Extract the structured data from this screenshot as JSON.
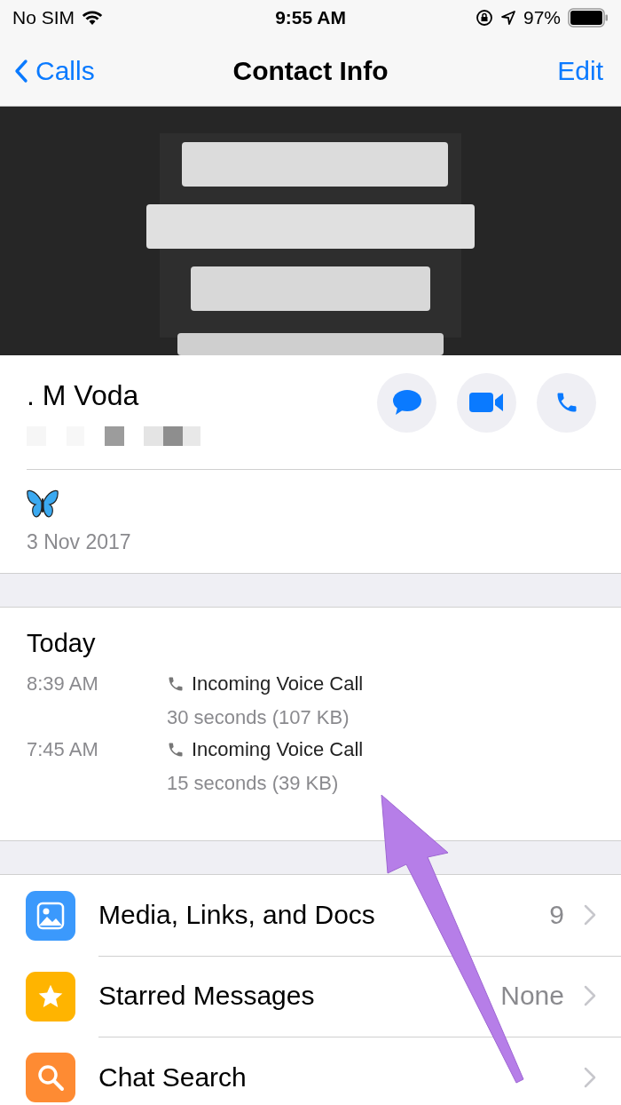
{
  "status_bar": {
    "carrier": "No SIM",
    "time": "9:55 AM",
    "battery": "97%"
  },
  "nav": {
    "back": "Calls",
    "title": "Contact Info",
    "action": "Edit"
  },
  "profile": {
    "name": ". M Voda"
  },
  "about": {
    "date": "3 Nov 2017"
  },
  "calls": {
    "heading": "Today",
    "entries": [
      {
        "time": "8:39 AM",
        "type": "Incoming Voice Call",
        "detail": "30 seconds (107 KB)"
      },
      {
        "time": "7:45 AM",
        "type": "Incoming Voice Call",
        "detail": "15 seconds (39 KB)"
      }
    ]
  },
  "menu": [
    {
      "kind": "media",
      "color": "#3b99fc",
      "label": "Media, Links, and Docs",
      "value": "9"
    },
    {
      "kind": "star",
      "color": "#ffb400",
      "label": "Starred Messages",
      "value": "None"
    },
    {
      "kind": "search",
      "color": "#fe8b33",
      "label": "Chat Search"
    }
  ]
}
